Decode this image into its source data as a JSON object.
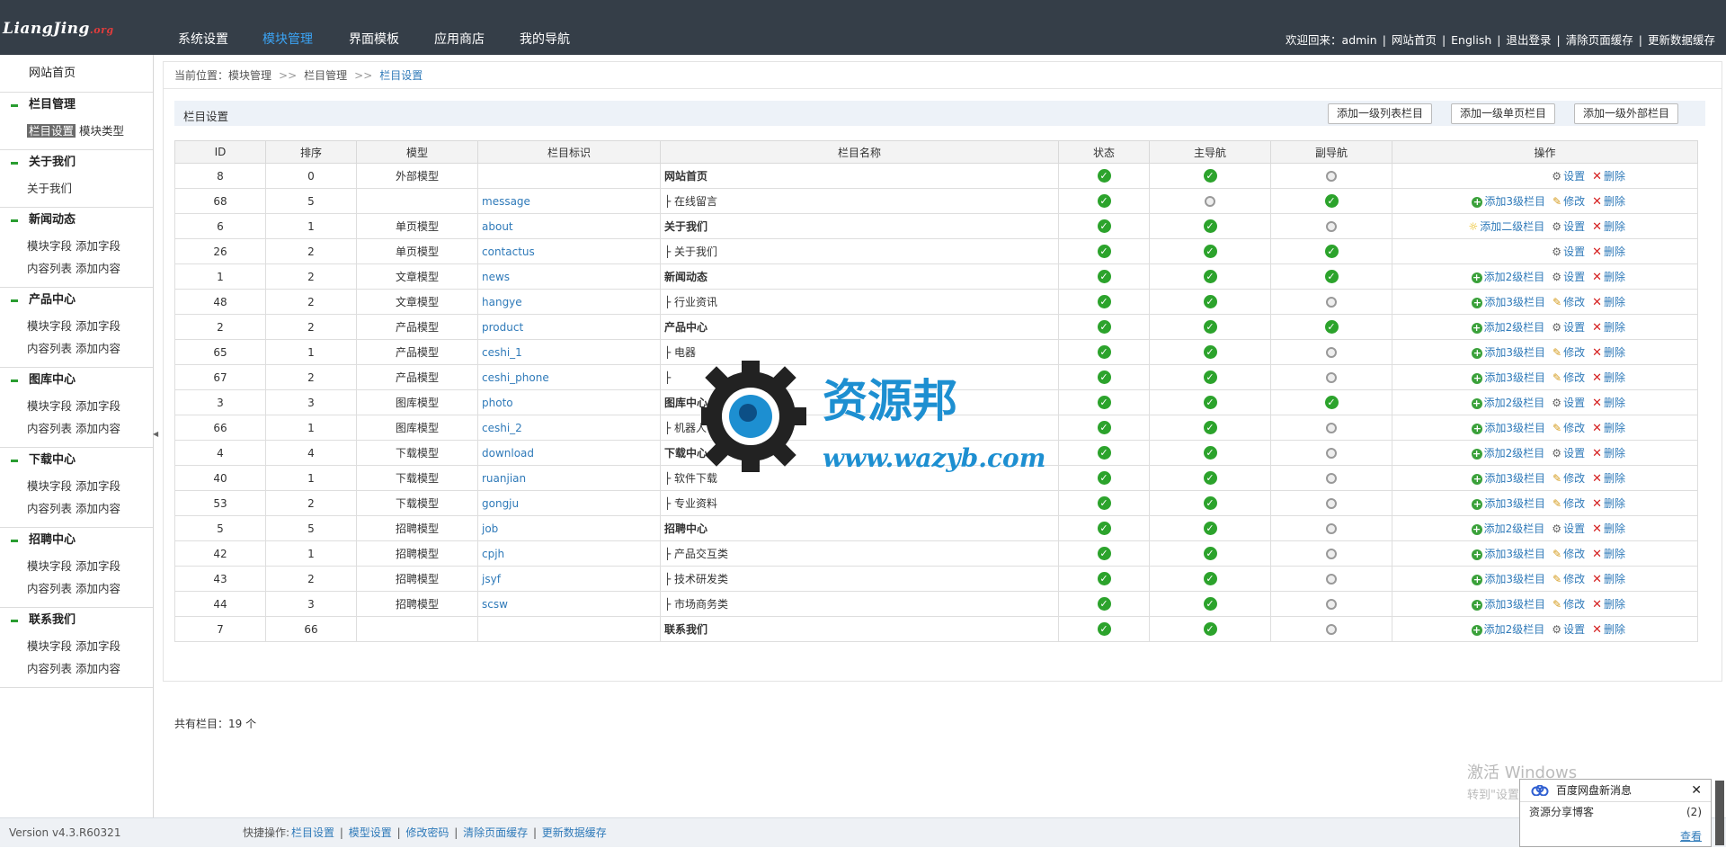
{
  "logo": {
    "text": "LiangJing",
    "suffix": ".org"
  },
  "topnav": [
    {
      "label": "系统设置",
      "active": false
    },
    {
      "label": "模块管理",
      "active": true
    },
    {
      "label": "界面模板",
      "active": false
    },
    {
      "label": "应用商店",
      "active": false
    },
    {
      "label": "我的导航",
      "active": false
    }
  ],
  "toplinks": {
    "welcome": "欢迎回来：",
    "user": "admin",
    "home": "网站首页",
    "lang": "English",
    "logout": "退出登录",
    "clear_page": "清除页面缓存",
    "update_data": "更新数据缓存",
    "sep": "|"
  },
  "sidebar": {
    "home": "网站首页",
    "groups": [
      {
        "title": "栏目管理",
        "links": [
          [
            "栏目设置",
            "模块类型"
          ]
        ],
        "selected": "栏目设置"
      },
      {
        "title": "关于我们",
        "links": [
          [
            "关于我们"
          ]
        ]
      },
      {
        "title": "新闻动态",
        "links": [
          [
            "模块字段",
            "添加字段"
          ],
          [
            "内容列表",
            "添加内容"
          ]
        ]
      },
      {
        "title": "产品中心",
        "links": [
          [
            "模块字段",
            "添加字段"
          ],
          [
            "内容列表",
            "添加内容"
          ]
        ]
      },
      {
        "title": "图库中心",
        "links": [
          [
            "模块字段",
            "添加字段"
          ],
          [
            "内容列表",
            "添加内容"
          ]
        ]
      },
      {
        "title": "下载中心",
        "links": [
          [
            "模块字段",
            "添加字段"
          ],
          [
            "内容列表",
            "添加内容"
          ]
        ]
      },
      {
        "title": "招聘中心",
        "links": [
          [
            "模块字段",
            "添加字段"
          ],
          [
            "内容列表",
            "添加内容"
          ]
        ]
      },
      {
        "title": "联系我们",
        "links": [
          [
            "模块字段",
            "添加字段"
          ],
          [
            "内容列表",
            "添加内容"
          ]
        ]
      }
    ]
  },
  "breadcrumb": {
    "prefix": "当前位置：",
    "items": [
      "模块管理",
      "栏目管理",
      "栏目设置"
    ],
    "sep": ">>"
  },
  "section": {
    "title": "栏目设置",
    "buttons": [
      "添加一级列表栏目",
      "添加一级单页栏目",
      "添加一级外部栏目"
    ]
  },
  "table": {
    "headers": [
      "ID",
      "排序",
      "模型",
      "栏目标识",
      "栏目名称",
      "状态",
      "主导航",
      "副导航",
      "操作"
    ],
    "rows": [
      {
        "id": "8",
        "sort": "0",
        "model": "外部模型",
        "mc": "mred",
        "ident": "",
        "name": "网站首页",
        "bold": true,
        "status": true,
        "main": true,
        "sub": false,
        "ops": [
          "set",
          "del"
        ]
      },
      {
        "id": "68",
        "sort": "5",
        "model": "",
        "mc": "mblack",
        "ident": "message",
        "name": "├ 在线留言",
        "bold": false,
        "status": true,
        "main": false,
        "sub": true,
        "ops": [
          "add3",
          "edit",
          "del"
        ]
      },
      {
        "id": "6",
        "sort": "1",
        "model": "单页模型",
        "mc": "mteal",
        "ident": "about",
        "name": "关于我们",
        "bold": true,
        "status": true,
        "main": true,
        "sub": false,
        "ops": [
          "add2b",
          "set",
          "del"
        ]
      },
      {
        "id": "26",
        "sort": "2",
        "model": "单页模型",
        "mc": "mteal",
        "ident": "contactus",
        "name": "├ 关于我们",
        "bold": false,
        "status": true,
        "main": true,
        "sub": true,
        "ops": [
          "set",
          "del"
        ]
      },
      {
        "id": "1",
        "sort": "2",
        "model": "文章模型",
        "mc": "mblack",
        "ident": "news",
        "name": "新闻动态",
        "bold": true,
        "status": true,
        "main": true,
        "sub": true,
        "ops": [
          "add2",
          "set",
          "del"
        ]
      },
      {
        "id": "48",
        "sort": "2",
        "model": "文章模型",
        "mc": "mblack",
        "ident": "hangye",
        "name": "├ 行业资讯",
        "bold": false,
        "status": true,
        "main": true,
        "sub": false,
        "ops": [
          "add3",
          "edit",
          "del"
        ]
      },
      {
        "id": "2",
        "sort": "2",
        "model": "产品模型",
        "mc": "mgreen",
        "ident": "product",
        "name": "产品中心",
        "bold": true,
        "status": true,
        "main": true,
        "sub": true,
        "ops": [
          "add2",
          "set",
          "del"
        ]
      },
      {
        "id": "65",
        "sort": "1",
        "model": "产品模型",
        "mc": "mgreen",
        "ident": "ceshi_1",
        "name": "├ 电器",
        "bold": false,
        "status": true,
        "main": true,
        "sub": false,
        "ops": [
          "add3",
          "edit",
          "del"
        ]
      },
      {
        "id": "67",
        "sort": "2",
        "model": "产品模型",
        "mc": "mgreen",
        "ident": "ceshi_phone",
        "name": "├",
        "bold": false,
        "status": true,
        "main": true,
        "sub": false,
        "ops": [
          "add3",
          "edit",
          "del"
        ]
      },
      {
        "id": "3",
        "sort": "3",
        "model": "图库模型",
        "mc": "morange",
        "ident": "photo",
        "name": "图库中心",
        "bold": true,
        "status": true,
        "main": true,
        "sub": true,
        "ops": [
          "add2",
          "set",
          "del"
        ]
      },
      {
        "id": "66",
        "sort": "1",
        "model": "图库模型",
        "mc": "morange",
        "ident": "ceshi_2",
        "name": "├ 机器人",
        "bold": false,
        "status": true,
        "main": true,
        "sub": false,
        "ops": [
          "add3",
          "edit",
          "del"
        ]
      },
      {
        "id": "4",
        "sort": "4",
        "model": "下载模型",
        "mc": "mblue",
        "ident": "download",
        "name": "下载中心",
        "bold": true,
        "status": true,
        "main": true,
        "sub": false,
        "ops": [
          "add2",
          "set",
          "del"
        ]
      },
      {
        "id": "40",
        "sort": "1",
        "model": "下载模型",
        "mc": "mblue",
        "ident": "ruanjian",
        "name": "├ 软件下载",
        "bold": false,
        "status": true,
        "main": true,
        "sub": false,
        "ops": [
          "add3",
          "edit",
          "del"
        ]
      },
      {
        "id": "53",
        "sort": "2",
        "model": "下载模型",
        "mc": "mblue",
        "ident": "gongju",
        "name": "├ 专业资料",
        "bold": false,
        "status": true,
        "main": true,
        "sub": false,
        "ops": [
          "add3",
          "edit",
          "del"
        ]
      },
      {
        "id": "5",
        "sort": "5",
        "model": "招聘模型",
        "mc": "mred",
        "ident": "job",
        "name": "招聘中心",
        "bold": true,
        "status": true,
        "main": true,
        "sub": false,
        "ops": [
          "add2",
          "set",
          "del"
        ]
      },
      {
        "id": "42",
        "sort": "1",
        "model": "招聘模型",
        "mc": "mred",
        "ident": "cpjh",
        "name": "├ 产品交互类",
        "bold": false,
        "status": true,
        "main": true,
        "sub": false,
        "ops": [
          "add3",
          "edit",
          "del"
        ]
      },
      {
        "id": "43",
        "sort": "2",
        "model": "招聘模型",
        "mc": "mred",
        "ident": "jsyf",
        "name": "├ 技术研发类",
        "bold": false,
        "status": true,
        "main": true,
        "sub": false,
        "ops": [
          "add3",
          "edit",
          "del"
        ]
      },
      {
        "id": "44",
        "sort": "3",
        "model": "招聘模型",
        "mc": "mred",
        "ident": "scsw",
        "name": "├ 市场商务类",
        "bold": false,
        "status": true,
        "main": true,
        "sub": false,
        "ops": [
          "add3",
          "edit",
          "del"
        ]
      },
      {
        "id": "7",
        "sort": "66",
        "model": "",
        "mc": "mblack",
        "ident": "",
        "name": "联系我们",
        "bold": true,
        "status": true,
        "main": true,
        "sub": false,
        "ops": [
          "add2",
          "set",
          "del"
        ]
      }
    ],
    "op_labels": {
      "set": "设置",
      "del": "删除",
      "edit": "修改",
      "add2": "添加2级栏目",
      "add3": "添加3级栏目",
      "add2b": "添加二级栏目"
    }
  },
  "count_text": "共有栏目：19 个",
  "watermark": {
    "title": "资源邦",
    "url": "www.wazyb.com"
  },
  "footer": {
    "version": "Version v4.3.R60321",
    "quick_label": "快捷操作:",
    "quick_links": [
      "栏目设置",
      "模型设置",
      "修改密码",
      "清除页面缓存",
      "更新数据缓存"
    ]
  },
  "activation": {
    "line1": "激活 Windows",
    "line2": "转到\"设置\""
  },
  "popup": {
    "title": "百度网盘新消息",
    "item": "资源分享博客",
    "count": "(2)",
    "view": "查看"
  },
  "colors": {
    "topbar": "#353e48",
    "active_nav": "#3ba4f5",
    "link": "#2f7ab9",
    "ok": "#2ca32c"
  }
}
